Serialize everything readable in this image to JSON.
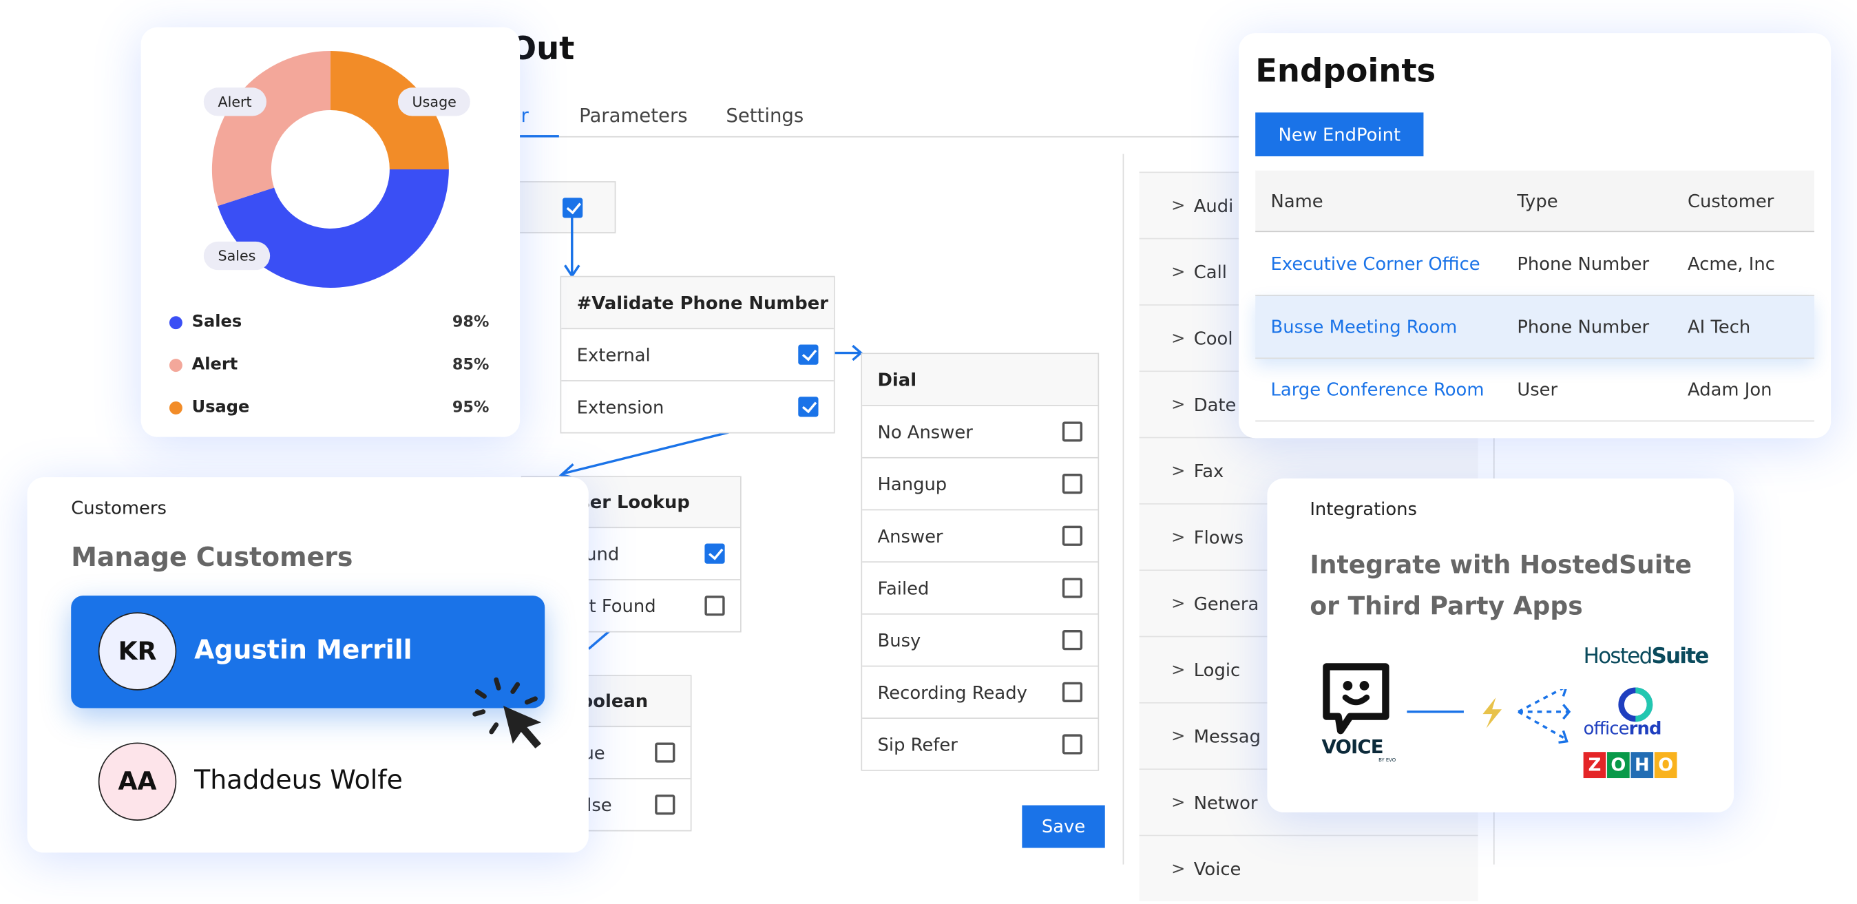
{
  "flow": {
    "title": "Out",
    "tabs": [
      {
        "label": "er",
        "active": true
      },
      {
        "label": "Parameters",
        "active": false
      },
      {
        "label": "Settings",
        "active": false
      }
    ],
    "validate_node": {
      "title": "#Validate Phone Number",
      "rows": [
        {
          "label": "External",
          "checked": true
        },
        {
          "label": "Extension",
          "checked": true
        }
      ]
    },
    "dial_node": {
      "title": "Dial",
      "rows": [
        {
          "label": "No Answer",
          "checked": false
        },
        {
          "label": "Hangup",
          "checked": false
        },
        {
          "label": "Answer",
          "checked": false
        },
        {
          "label": "Failed",
          "checked": false
        },
        {
          "label": "Busy",
          "checked": false
        },
        {
          "label": "Recording Ready",
          "checked": false
        },
        {
          "label": "Sip Refer",
          "checked": false
        }
      ]
    },
    "lookup_node": {
      "title": "User Lookup",
      "rows": [
        {
          "label": "Found",
          "checked": true
        },
        {
          "label": "Not Found",
          "checked": false
        }
      ]
    },
    "boolean_node": {
      "title": "Boolean",
      "rows": [
        {
          "label": "True",
          "checked": false
        },
        {
          "label": "False",
          "checked": false
        }
      ]
    },
    "save_label": "Save",
    "categories": [
      "Audi",
      "Call",
      "Cool",
      "Date",
      "Fax",
      "Flows",
      "Genera",
      "Logic",
      "Messag",
      "Networ",
      "Voice"
    ]
  },
  "donut": {
    "slices": [
      {
        "name": "Sales",
        "value": 98,
        "color": "#3a4ff5"
      },
      {
        "name": "Alert",
        "value": 85,
        "color": "#f3a79a"
      },
      {
        "name": "Usage",
        "value": 95,
        "color": "#f28c28"
      }
    ],
    "legend": [
      {
        "label": "Sales",
        "pct": "98%",
        "color": "#3a4ff5"
      },
      {
        "label": "Alert",
        "pct": "85%",
        "color": "#f3a79a"
      },
      {
        "label": "Usage",
        "pct": "95%",
        "color": "#f28c28"
      }
    ]
  },
  "customers": {
    "label": "Customers",
    "heading": "Manage Customers",
    "items": [
      {
        "initials": "KR",
        "name": "Agustin Merrill",
        "selected": true
      },
      {
        "initials": "AA",
        "name": "Thaddeus Wolfe",
        "selected": false
      }
    ]
  },
  "endpoints": {
    "title": "Endpoints",
    "new_button": "New EndPoint",
    "columns": [
      "Name",
      "Type",
      "Customer"
    ],
    "rows": [
      [
        "Executive Corner Office",
        "Phone Number",
        "Acme, Inc"
      ],
      [
        "Busse Meeting Room",
        "Phone Number",
        "AI Tech"
      ],
      [
        "Large Conference Room",
        "User",
        "Adam Jon"
      ]
    ]
  },
  "integrations": {
    "label": "Integrations",
    "heading_line1": "Integrate with HostedSuite",
    "heading_line2": "or Third Party Apps",
    "logos": {
      "voice": "VOICE",
      "voice_sub": "BY EVO",
      "hostedsuite_a": "Hosted",
      "hostedsuite_b": "Suite",
      "officernd_a": "office",
      "officernd_b": "rnd",
      "zoho": [
        "Z",
        "O",
        "H",
        "O"
      ]
    }
  },
  "colors": {
    "accent": "#1a73e8"
  }
}
